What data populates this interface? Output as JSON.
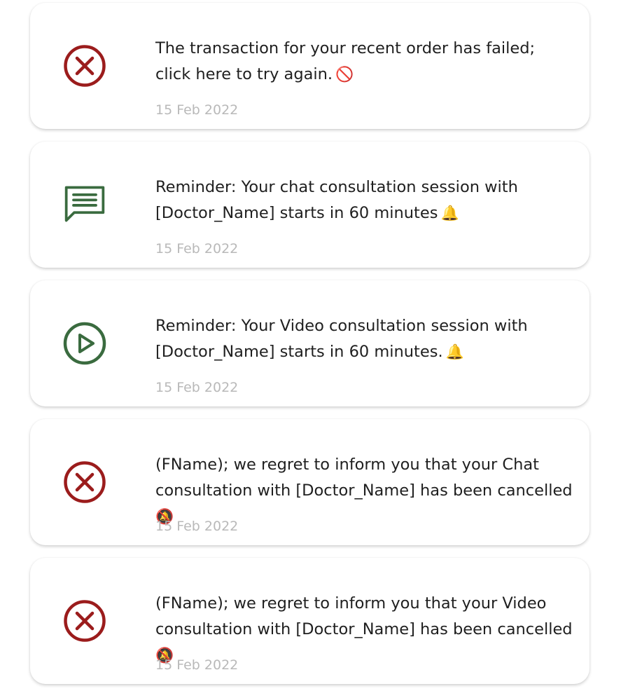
{
  "colors": {
    "error": "#9b1c1c",
    "success": "#3a6b3f",
    "date": "#b9b9b9",
    "text": "#1f1f1f"
  },
  "notifications": [
    {
      "icon": "error-circle-icon",
      "message": "The transaction for your recent order has failed;\nclick here to try again.",
      "emoji": "🚫",
      "date": "15 Feb 2022"
    },
    {
      "icon": "chat-bubble-icon",
      "message": "Reminder: Your chat consultation session with\n[Doctor_Name] starts in 60 minutes",
      "emoji": "🔔",
      "date": "15 Feb 2022"
    },
    {
      "icon": "play-circle-icon",
      "message": "Reminder: Your Video consultation session with\n[Doctor_Name] starts in 60 minutes.",
      "emoji": "🔔",
      "date": "15 Feb 2022"
    },
    {
      "icon": "error-circle-icon",
      "message": "(FName); we regret to inform you that your Chat\nconsultation with [Doctor_Name] has been cancelled",
      "emoji": "🔕",
      "date": "15 Feb 2022"
    },
    {
      "icon": "error-circle-icon",
      "message": "(FName); we regret to inform you that your Video\nconsultation with [Doctor_Name] has been cancelled",
      "emoji": "🔕",
      "date": "15 Feb 2022"
    }
  ]
}
